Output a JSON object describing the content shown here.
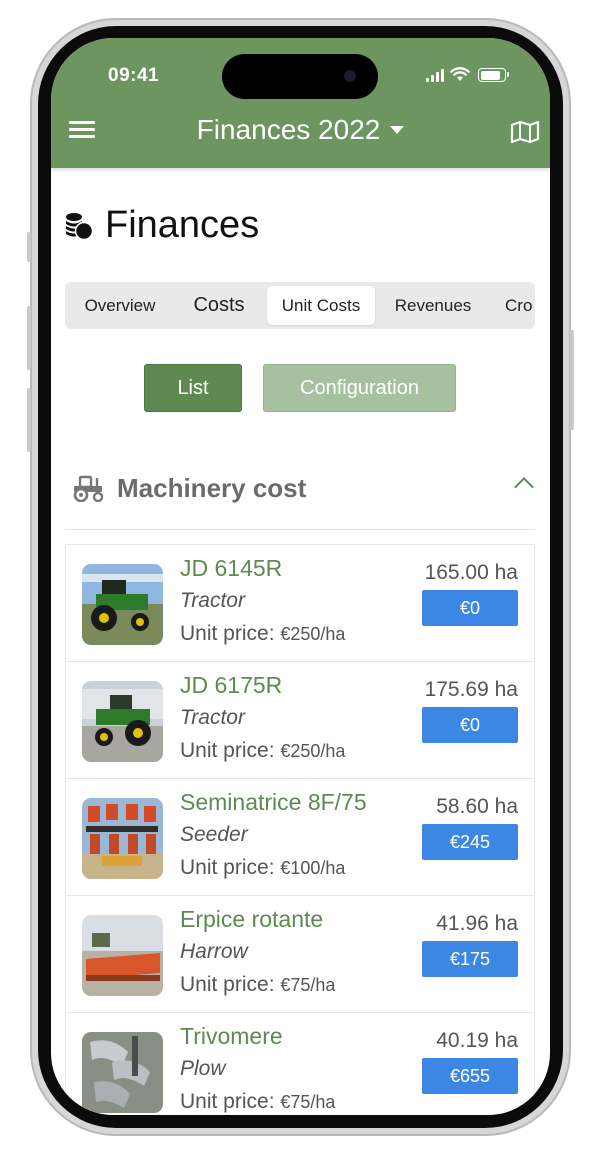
{
  "status": {
    "time": "09:41"
  },
  "header": {
    "title": "Finances 2022",
    "menu_icon": "hamburger-icon",
    "map_icon": "map-icon"
  },
  "page": {
    "title": "Finances",
    "icon": "coins-icon"
  },
  "tabs": [
    {
      "label": "Overview"
    },
    {
      "label": "Costs"
    },
    {
      "label": "Unit Costs",
      "active": true
    },
    {
      "label": "Revenues"
    },
    {
      "label": "Cro"
    }
  ],
  "view_buttons": {
    "list": "List",
    "configuration": "Configuration"
  },
  "section": {
    "title": "Machinery cost",
    "icon": "tractor-icon"
  },
  "unit_price_label": "Unit price:",
  "items": [
    {
      "name": "JD 6145R",
      "type": "Tractor",
      "unit_price": "€250/ha",
      "area": "165.00 ha",
      "cost": "€0"
    },
    {
      "name": "JD 6175R",
      "type": "Tractor",
      "unit_price": "€250/ha",
      "area": "175.69 ha",
      "cost": "€0"
    },
    {
      "name": "Seminatrice 8F/75",
      "type": "Seeder",
      "unit_price": "€100/ha",
      "area": "58.60 ha",
      "cost": "€245"
    },
    {
      "name": "Erpice rotante",
      "type": "Harrow",
      "unit_price": "€75/ha",
      "area": "41.96 ha",
      "cost": "€175"
    },
    {
      "name": "Trivomere",
      "type": "Plow",
      "unit_price": "€75/ha",
      "area": "40.19 ha",
      "cost": "€655"
    }
  ],
  "colors": {
    "header": "#6c955f",
    "accent": "#5e8a52",
    "cost_button": "#3c87e3"
  }
}
